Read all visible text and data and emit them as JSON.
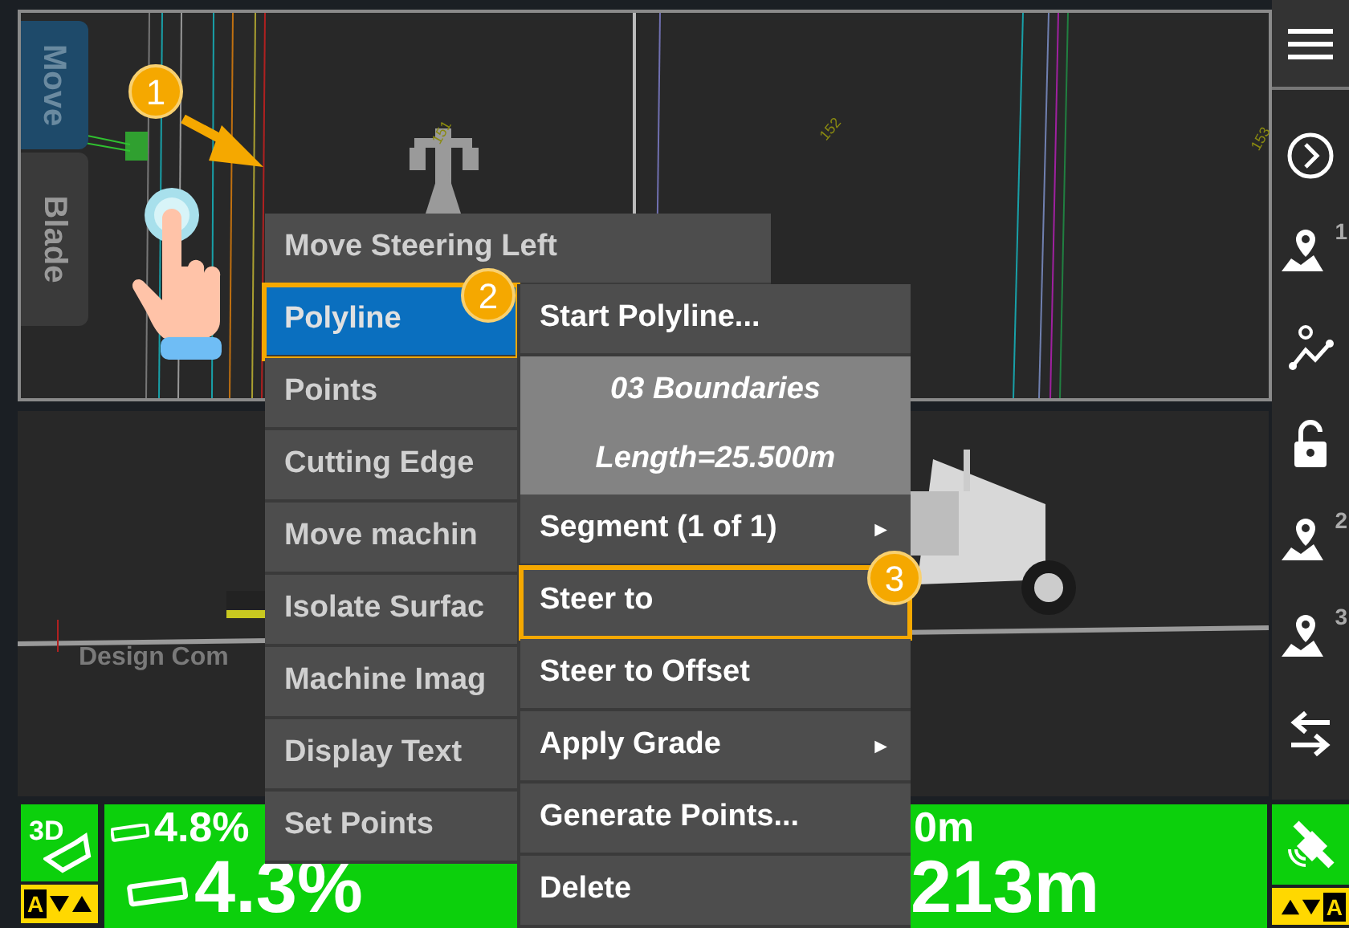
{
  "plan_view": {
    "side_tabs": [
      {
        "label": "Move",
        "selected": true
      },
      {
        "label": "Blade",
        "selected": false
      }
    ],
    "station_labels": [
      "151",
      "152",
      "153"
    ]
  },
  "profile_view": {
    "label": "Design Com"
  },
  "context_menu": {
    "items": [
      {
        "label": "Move Steering Left",
        "selected": false,
        "highlighted": false
      },
      {
        "label": "Polyline",
        "selected": true,
        "highlighted": true
      },
      {
        "label": "Points",
        "selected": false,
        "highlighted": false
      },
      {
        "label": "Cutting Edge",
        "selected": false,
        "highlighted": false
      },
      {
        "label": "Move machin",
        "selected": false,
        "highlighted": false
      },
      {
        "label": "Isolate Surfac",
        "selected": false,
        "highlighted": false
      },
      {
        "label": "Machine Imag",
        "selected": false,
        "highlighted": false
      },
      {
        "label": "Display Text",
        "selected": false,
        "highlighted": false
      },
      {
        "label": "Set Points",
        "selected": false,
        "highlighted": false
      }
    ]
  },
  "submenu": {
    "items": [
      {
        "kind": "action",
        "label": "Start Polyline...",
        "highlighted": false
      },
      {
        "kind": "info",
        "label": "03 Boundaries",
        "highlighted": false
      },
      {
        "kind": "info",
        "label": "Length=25.500m",
        "highlighted": false
      },
      {
        "kind": "submenu",
        "label": "Segment (1 of 1)",
        "arrow": "►",
        "highlighted": false
      },
      {
        "kind": "action",
        "label": "Steer to",
        "highlighted": true
      },
      {
        "kind": "action",
        "label": "Steer to Offset",
        "highlighted": false
      },
      {
        "kind": "submenu",
        "label": "Apply Grade",
        "arrow": "►",
        "highlighted": false
      },
      {
        "kind": "action",
        "label": "Generate Points...",
        "highlighted": false
      },
      {
        "kind": "action",
        "label": "Delete",
        "highlighted": false
      }
    ]
  },
  "callouts": [
    "1",
    "2",
    "3"
  ],
  "toolbar": {
    "items": [
      {
        "kind": "menu"
      },
      {
        "kind": "chevron"
      },
      {
        "kind": "pin",
        "badge": "1"
      },
      {
        "kind": "polyline"
      },
      {
        "kind": "lock"
      },
      {
        "kind": "pin",
        "badge": "2"
      },
      {
        "kind": "pin",
        "badge": "3"
      },
      {
        "kind": "swap"
      }
    ]
  },
  "status_bar": {
    "left_mode": "3D",
    "left_auto": "A",
    "grade_small": "4.8%",
    "grade_large": "4.3%",
    "distance_small": "0m",
    "distance_large": "213m",
    "right_auto": "A"
  }
}
